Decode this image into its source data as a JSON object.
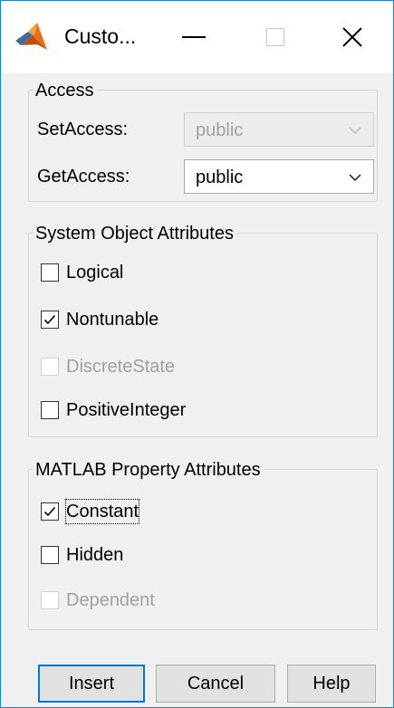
{
  "window": {
    "title": "Custo..."
  },
  "access": {
    "legend": "Access",
    "set_label": "SetAccess:",
    "set_value": "public",
    "get_label": "GetAccess:",
    "get_value": "public"
  },
  "system_attrs": {
    "legend": "System Object Attributes",
    "items": [
      {
        "label": "Logical",
        "checked": false,
        "enabled": true
      },
      {
        "label": "Nontunable",
        "checked": true,
        "enabled": true
      },
      {
        "label": "DiscreteState",
        "checked": false,
        "enabled": false
      },
      {
        "label": "PositiveInteger",
        "checked": false,
        "enabled": true
      }
    ]
  },
  "matlab_attrs": {
    "legend": "MATLAB Property Attributes",
    "items": [
      {
        "label": "Constant",
        "checked": true,
        "enabled": true,
        "focused": true
      },
      {
        "label": "Hidden",
        "checked": false,
        "enabled": true
      },
      {
        "label": "Dependent",
        "checked": false,
        "enabled": false
      }
    ]
  },
  "buttons": {
    "insert": "Insert",
    "cancel": "Cancel",
    "help": "Help"
  },
  "colors": {
    "focus_border": "#0078d7",
    "window_border": "#1883d7",
    "disabled_text": "#a0a0a0"
  }
}
